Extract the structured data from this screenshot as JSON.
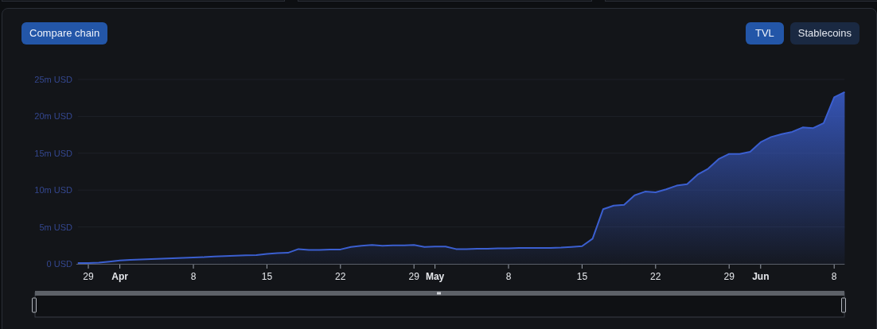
{
  "toolbar": {
    "compare_button": "Compare chain",
    "tabs": [
      {
        "label": "TVL",
        "selected": true
      },
      {
        "label": "Stablecoins",
        "selected": false
      }
    ]
  },
  "chart": {
    "chart_data": {
      "type": "area",
      "grid": true,
      "ylim": [
        0,
        25
      ],
      "categories": [
        null,
        "29",
        null,
        null,
        "Apr",
        null,
        null,
        null,
        null,
        null,
        null,
        "8",
        null,
        null,
        null,
        null,
        null,
        null,
        "15",
        null,
        null,
        null,
        null,
        null,
        null,
        "22",
        null,
        null,
        null,
        null,
        null,
        null,
        "29",
        null,
        "May",
        null,
        null,
        null,
        null,
        null,
        null,
        "8",
        null,
        null,
        null,
        null,
        null,
        null,
        "15",
        null,
        null,
        null,
        null,
        null,
        null,
        "22",
        null,
        null,
        null,
        null,
        null,
        null,
        "29",
        null,
        null,
        "Jun",
        null,
        null,
        null,
        null,
        null,
        null,
        "8",
        null
      ],
      "yticks": [
        {
          "value": 0,
          "label": "0 USD"
        },
        {
          "value": 5,
          "label": "5m USD"
        },
        {
          "value": 10,
          "label": "10m USD"
        },
        {
          "value": 15,
          "label": "15m USD"
        },
        {
          "value": 20,
          "label": "20m USD"
        },
        {
          "value": 25,
          "label": "25m USD"
        }
      ],
      "series": [
        {
          "color": "#3b5fd0",
          "values": [
            0.1,
            0.1,
            0.15,
            0.3,
            0.45,
            0.55,
            0.6,
            0.65,
            0.7,
            0.75,
            0.8,
            0.85,
            0.9,
            1.0,
            1.05,
            1.1,
            1.15,
            1.2,
            1.35,
            1.45,
            1.5,
            2.0,
            1.9,
            1.9,
            1.95,
            1.95,
            2.3,
            2.45,
            2.55,
            2.45,
            2.5,
            2.5,
            2.55,
            2.3,
            2.35,
            2.35,
            2.0,
            2.0,
            2.05,
            2.05,
            2.1,
            2.1,
            2.15,
            2.15,
            2.15,
            2.15,
            2.2,
            2.3,
            2.4,
            3.4,
            7.4,
            7.9,
            8.0,
            9.3,
            9.8,
            9.7,
            10.1,
            10.6,
            10.8,
            12.1,
            12.9,
            14.2,
            14.9,
            14.9,
            15.2,
            16.5,
            17.2,
            17.6,
            17.9,
            18.5,
            18.4,
            19.1,
            22.6,
            23.3
          ]
        }
      ]
    }
  }
}
